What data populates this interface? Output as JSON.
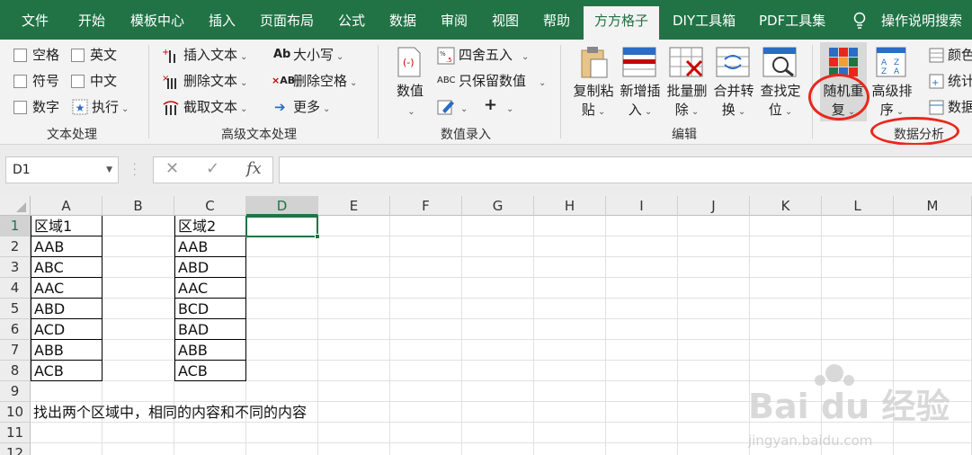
{
  "menu": {
    "tabs": [
      {
        "label": "文件"
      },
      {
        "label": "开始"
      },
      {
        "label": "模板中心"
      },
      {
        "label": "插入"
      },
      {
        "label": "页面布局"
      },
      {
        "label": "公式"
      },
      {
        "label": "数据"
      },
      {
        "label": "审阅"
      },
      {
        "label": "视图"
      },
      {
        "label": "帮助"
      },
      {
        "label": "方方格子",
        "active": true
      },
      {
        "label": "DIY工具箱"
      },
      {
        "label": "PDF工具集"
      }
    ],
    "tell_me": "操作说明搜索"
  },
  "ribbon": {
    "text_group": {
      "label": "文本处理",
      "checks": [
        "空格",
        "英文",
        "符号",
        "中文",
        "数字"
      ],
      "execute": "执行"
    },
    "adv_text_group": {
      "label": "高级文本处理",
      "insert_text": "插入文本",
      "delete_text": "删除文本",
      "extract_text": "截取文本",
      "case": "大小写",
      "delete_space": "删除空格",
      "more": "更多"
    },
    "number_group": {
      "label": "数值录入",
      "value": "数值",
      "round": "四舍五入",
      "keep_value": "只保留数值"
    },
    "edit_group": {
      "label": "编辑",
      "copy_paste": [
        "复制粘",
        "贴"
      ],
      "new_insert": [
        "新增插",
        "入"
      ],
      "batch_delete": [
        "批量删",
        "除"
      ],
      "merge_convert": [
        "合并转",
        "换"
      ],
      "find_locate": [
        "查找定",
        "位"
      ]
    },
    "analysis_group": {
      "label": "数据分析",
      "random_repeat": [
        "随机重",
        "复"
      ],
      "adv_sort": [
        "高级排",
        "序"
      ],
      "color": "颜色",
      "stats": "统计",
      "data": "数据"
    },
    "annotation_color": "#e8281c"
  },
  "formula_bar": {
    "name_box": "D1",
    "cancel": "✕",
    "enter": "✓",
    "fx": "fx",
    "value": ""
  },
  "sheet": {
    "columns": [
      "A",
      "B",
      "C",
      "D",
      "E",
      "F",
      "G",
      "H",
      "I",
      "J",
      "K",
      "L",
      "M"
    ],
    "selected_column": "D",
    "rows": [
      "1",
      "2",
      "3",
      "4",
      "5",
      "6",
      "7",
      "8",
      "9",
      "10",
      "11",
      "12"
    ],
    "selected_row": "1",
    "region1": [
      "区域1",
      "AAB",
      "ABC",
      "AAC",
      "ABD",
      "ACD",
      "ABB",
      "ACB"
    ],
    "region2": [
      "区域2",
      "AAB",
      "ABD",
      "AAC",
      "BCD",
      "BAD",
      "ABB",
      "ACB"
    ],
    "note": "找出两个区域中，相同的内容和不同的内容"
  },
  "watermark": {
    "brand": "Bai du 经验",
    "url": "jingyan.baidu.com"
  },
  "accent_color": "#217346"
}
